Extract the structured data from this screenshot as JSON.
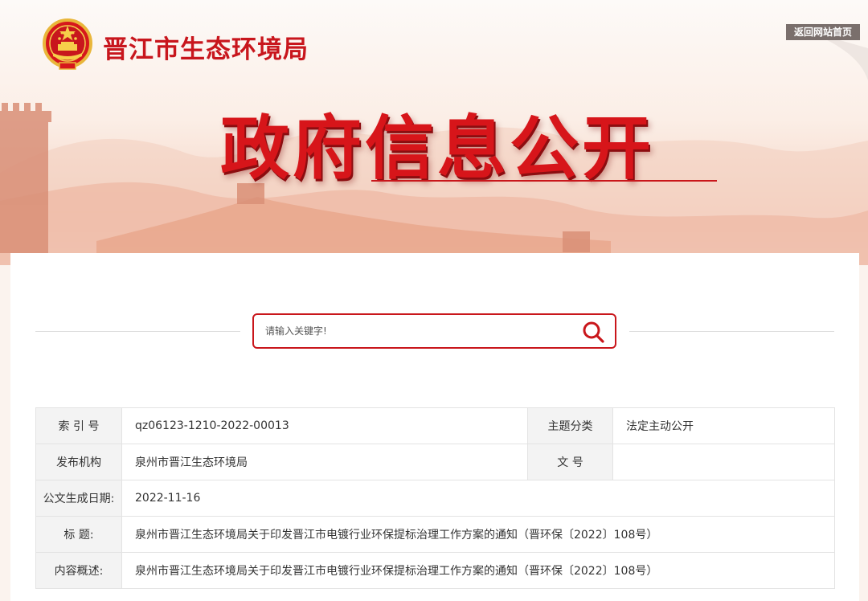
{
  "header": {
    "site_name": "晋江市生态环境局",
    "back_home_label": "返回网站首页",
    "banner_title": "政府信息公开"
  },
  "search": {
    "placeholder": "请输入关键字!",
    "icon": "search-icon"
  },
  "info_table": {
    "index_no_label": "索 引 号",
    "index_no_value": "qz06123-1210-2022-00013",
    "topic_label": "主题分类",
    "topic_value": "法定主动公开",
    "publisher_label": "发布机构",
    "publisher_value": "泉州市晋江生态环境局",
    "doc_no_label": "文 号",
    "doc_no_value": "",
    "date_label": "公文生成日期:",
    "date_value": "2022-11-16",
    "title_label": "标 题:",
    "title_value": "泉州市晋江生态环境局关于印发晋江市电镀行业环保提标治理工作方案的通知（晋环保〔2022〕108号）",
    "summary_label": "内容概述:",
    "summary_value": "泉州市晋江生态环境局关于印发晋江市电镀行业环保提标治理工作方案的通知（晋环保〔2022〕108号）"
  },
  "colors": {
    "brand_red": "#c8161d",
    "back_button_bg": "#7a6f6c"
  }
}
